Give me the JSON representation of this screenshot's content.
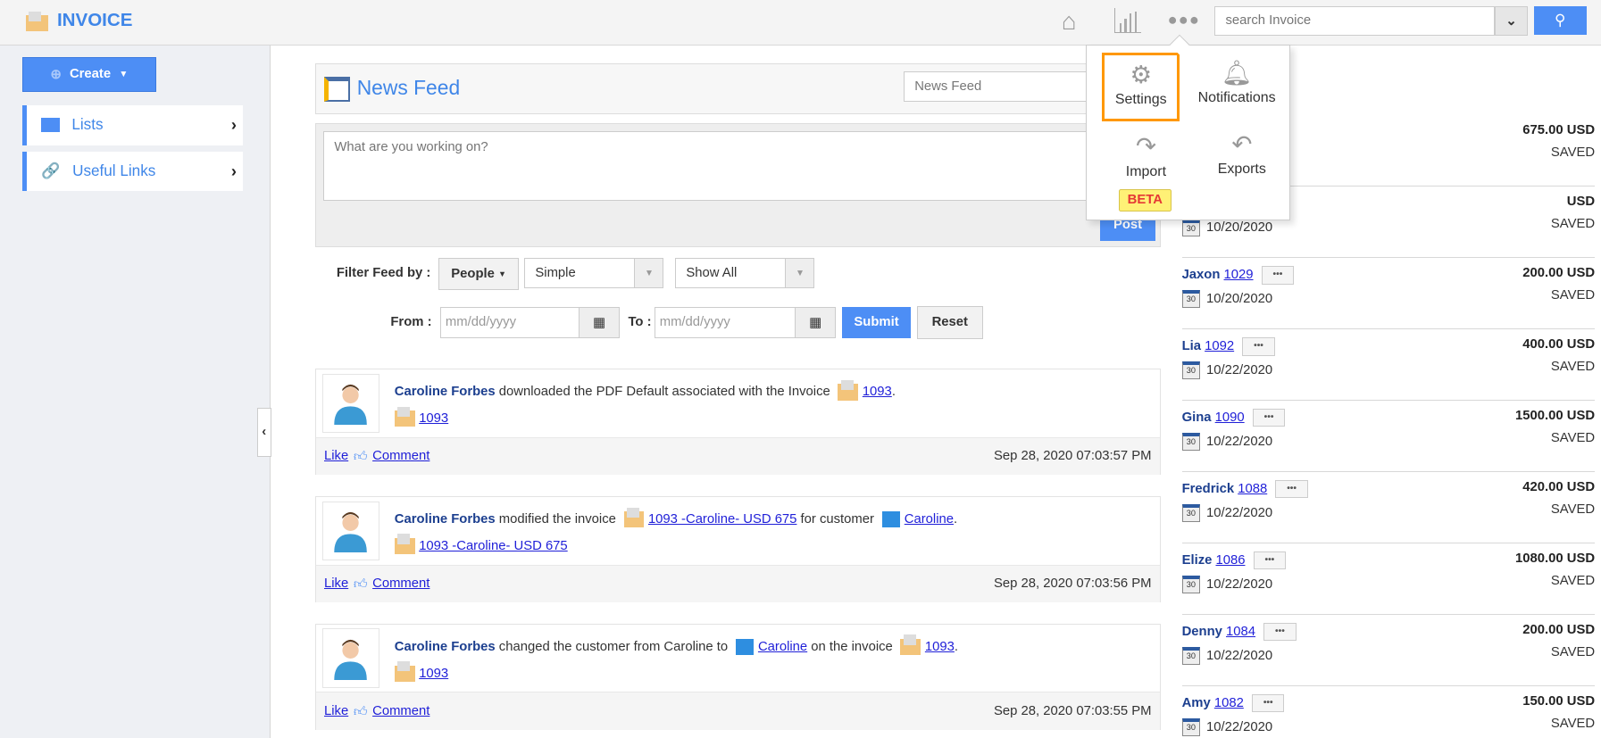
{
  "header": {
    "app_title": "INVOICE",
    "search_placeholder": "search Invoice"
  },
  "sidebar": {
    "create_label": "Create",
    "items": [
      {
        "label": "Lists"
      },
      {
        "label": "Useful Links"
      }
    ]
  },
  "newsfeed": {
    "title": "News Feed",
    "view_select": "News Feed",
    "composer_placeholder": "What are you working on?",
    "post_label": "Post",
    "filter": {
      "label": "Filter Feed by :",
      "people": "People",
      "type_select": "Simple",
      "show_select": "Show All",
      "from_label": "From :",
      "to_label": "To :",
      "date_placeholder": "mm/dd/yyyy",
      "submit": "Submit",
      "reset": "Reset"
    },
    "items": [
      {
        "user": "Caroline Forbes",
        "text1": " downloaded the PDF Default associated with the Invoice ",
        "link1": "1093",
        "text2": "",
        "link2": "",
        "text3": "",
        "sub_link": "1093",
        "like": "Like",
        "comment": "Comment",
        "timestamp": "Sep 28, 2020 07:03:57 PM"
      },
      {
        "user": "Caroline Forbes",
        "text1": " modified the invoice ",
        "link1": "1093 -Caroline- USD 675",
        "text2": " for customer ",
        "link2": "Caroline",
        "text3": "",
        "sub_link": "1093 -Caroline- USD 675",
        "like": "Like",
        "comment": "Comment",
        "timestamp": "Sep 28, 2020 07:03:56 PM"
      },
      {
        "user": "Caroline Forbes",
        "text1": " changed the customer from Caroline to ",
        "link1": "Caroline",
        "text2": " on the invoice ",
        "link2": "1093",
        "text3": "",
        "sub_link": "1093",
        "like": "Like",
        "comment": "Comment",
        "timestamp": "Sep 28, 2020 07:03:55 PM"
      }
    ]
  },
  "invoices": {
    "title_partial": "ices",
    "rows": [
      {
        "name": "",
        "number": "",
        "date": "",
        "amount": "675.00 USD",
        "status": "SAVED"
      },
      {
        "name": "",
        "number": "",
        "date": "10/20/2020",
        "amount": "USD",
        "status": "SAVED"
      },
      {
        "name": "Jaxon",
        "number": "1029",
        "date": "10/20/2020",
        "amount": "200.00 USD",
        "status": "SAVED"
      },
      {
        "name": "Lia",
        "number": "1092",
        "date": "10/22/2020",
        "amount": "400.00 USD",
        "status": "SAVED"
      },
      {
        "name": "Gina",
        "number": "1090",
        "date": "10/22/2020",
        "amount": "1500.00 USD",
        "status": "SAVED"
      },
      {
        "name": "Fredrick",
        "number": "1088",
        "date": "10/22/2020",
        "amount": "420.00 USD",
        "status": "SAVED"
      },
      {
        "name": "Elize",
        "number": "1086",
        "date": "10/22/2020",
        "amount": "1080.00 USD",
        "status": "SAVED"
      },
      {
        "name": "Denny",
        "number": "1084",
        "date": "10/22/2020",
        "amount": "200.00 USD",
        "status": "SAVED"
      },
      {
        "name": "Amy",
        "number": "1082",
        "date": "10/22/2020",
        "amount": "150.00 USD",
        "status": "SAVED"
      }
    ]
  },
  "popup": {
    "settings": "Settings",
    "notifications": "Notifications",
    "import": "Import",
    "beta": "BETA",
    "exports": "Exports"
  },
  "colors": {
    "accent": "#4d8ef5",
    "highlight": "#ff9800",
    "beta_bg": "#fff176",
    "beta_text": "#e53935"
  }
}
